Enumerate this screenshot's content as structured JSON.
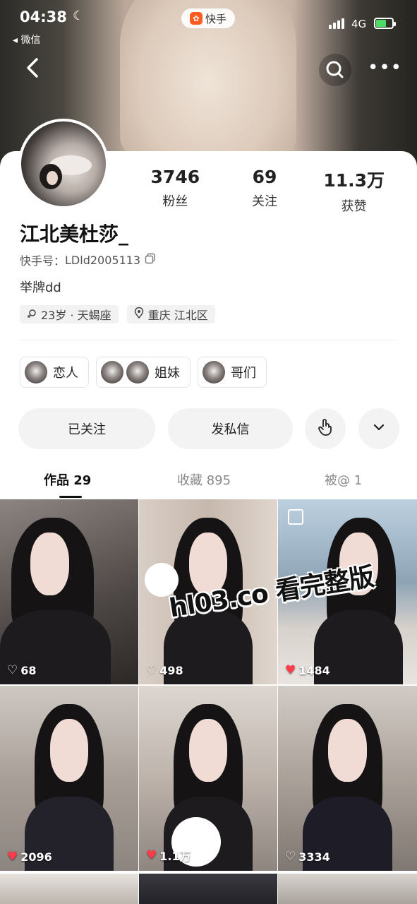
{
  "status_bar": {
    "time": "04:38",
    "back_app": "◂ 微信",
    "app_pill": "快手",
    "network": "4G"
  },
  "profile": {
    "name": "江北美杜莎_",
    "kuaishou_id_label": "快手号：",
    "kuaishou_id": "LDld2005113",
    "bio": "举牌dd",
    "tags": [
      "23岁 · 天蝎座",
      "重庆 江北区"
    ],
    "stats": [
      {
        "value": "3746",
        "label": "粉丝"
      },
      {
        "value": "69",
        "label": "关注"
      },
      {
        "value": "11.3万",
        "label": "获赞"
      }
    ],
    "relations": [
      "恋人",
      "姐妹",
      "哥们"
    ]
  },
  "actions": {
    "follow": "已关注",
    "message": "发私信"
  },
  "tabs": [
    {
      "label": "作品 29"
    },
    {
      "label": "收藏 895"
    },
    {
      "label": "被@ 1"
    }
  ],
  "posts": [
    {
      "likes": "68",
      "liked": false,
      "bg": "#6b6462"
    },
    {
      "likes": "498",
      "liked": false,
      "bg": "#c9bcb2"
    },
    {
      "likes": "1484",
      "liked": true,
      "bg": "#8fa7bb"
    },
    {
      "likes": "2096",
      "liked": true,
      "bg": "#a79f98"
    },
    {
      "likes": "1.1万",
      "liked": true,
      "bg": "#b8aea6"
    },
    {
      "likes": "3334",
      "liked": false,
      "bg": "#a59d95"
    }
  ],
  "watermark": "hl03.co 看完整版",
  "colors": {
    "accent_red": "#ff3b4a",
    "battery": "#4cd964",
    "app_orange": "#ff5a1f"
  }
}
